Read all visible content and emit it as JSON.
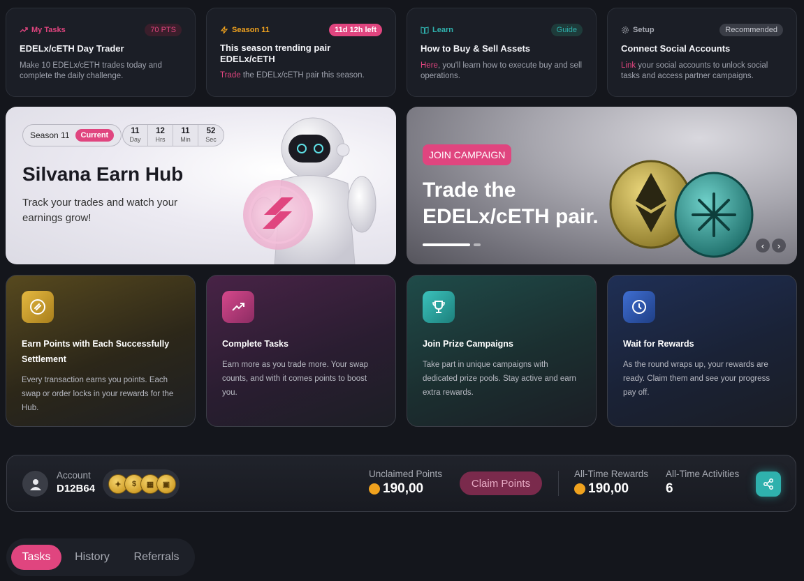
{
  "task_cards": [
    {
      "category": "My Tasks",
      "badge": "70 PTS",
      "title": "EDELx/cETH Day Trader",
      "desc": "Make 10 EDELx/cETH trades today and complete the daily challenge.",
      "accent": "#e0457f"
    },
    {
      "category": "Season 11",
      "badge": "11d 12h left",
      "title": "This season trending pair EDELx/cETH",
      "desc_link": "Trade",
      "desc": " the EDELx/cETH pair this season.",
      "accent": "#f0a21e"
    },
    {
      "category": "Learn",
      "badge": "Guide",
      "title": "How to Buy & Sell Assets",
      "desc_link": "Here",
      "desc": ", you'll learn how to execute buy and sell operations.",
      "accent": "#2fb1ad"
    },
    {
      "category": "Setup",
      "badge": "Recommended",
      "title": "Connect Social Accounts",
      "desc_link": "Link",
      "desc": " your social accounts to unlock social tasks and access partner campaigns.",
      "accent": "#a7aab3"
    }
  ],
  "hero": {
    "season": "Season 11",
    "current": "Current",
    "countdown": [
      {
        "num": "11",
        "label": "Day"
      },
      {
        "num": "12",
        "label": "Hrs"
      },
      {
        "num": "11",
        "label": "Min"
      },
      {
        "num": "52",
        "label": "Sec"
      }
    ],
    "title": "Silvana Earn Hub",
    "subtitle": "Track your trades and watch your earnings grow!"
  },
  "campaign": {
    "button": "JOIN CAMPAIGN",
    "title": "Trade the EDELx/cETH pair.",
    "prev": "‹",
    "next": "›"
  },
  "steps": [
    {
      "title": "Earn Points with Each Successfully Settlement",
      "desc": "Every transaction earns you points. Each swap or order locks in your rewards for the Hub.",
      "icon": "coin-icon"
    },
    {
      "title": "Complete Tasks",
      "desc": "Earn more as you trade more. Your swap counts, and with it comes points to boost you.",
      "icon": "trending-up-icon"
    },
    {
      "title": "Join Prize Campaigns",
      "desc": "Take part in unique campaigns with dedicated prize pools. Stay active and earn extra rewards.",
      "icon": "trophy-icon"
    },
    {
      "title": "Wait for Rewards",
      "desc": "As the round wraps up, your rewards are ready. Claim them and see your progress pay off.",
      "icon": "clock-icon"
    }
  ],
  "account": {
    "label": "Account",
    "id": "D12B64",
    "unclaimed_label": "Unclaimed Points",
    "unclaimed_value": "190,00",
    "claim_button": "Claim Points",
    "alltime_rewards_label": "All-Time Rewards",
    "alltime_rewards_value": "190,00",
    "alltime_activities_label": "All-Time Activities",
    "alltime_activities_value": "6"
  },
  "tabs": [
    "Tasks",
    "History",
    "Referrals"
  ]
}
